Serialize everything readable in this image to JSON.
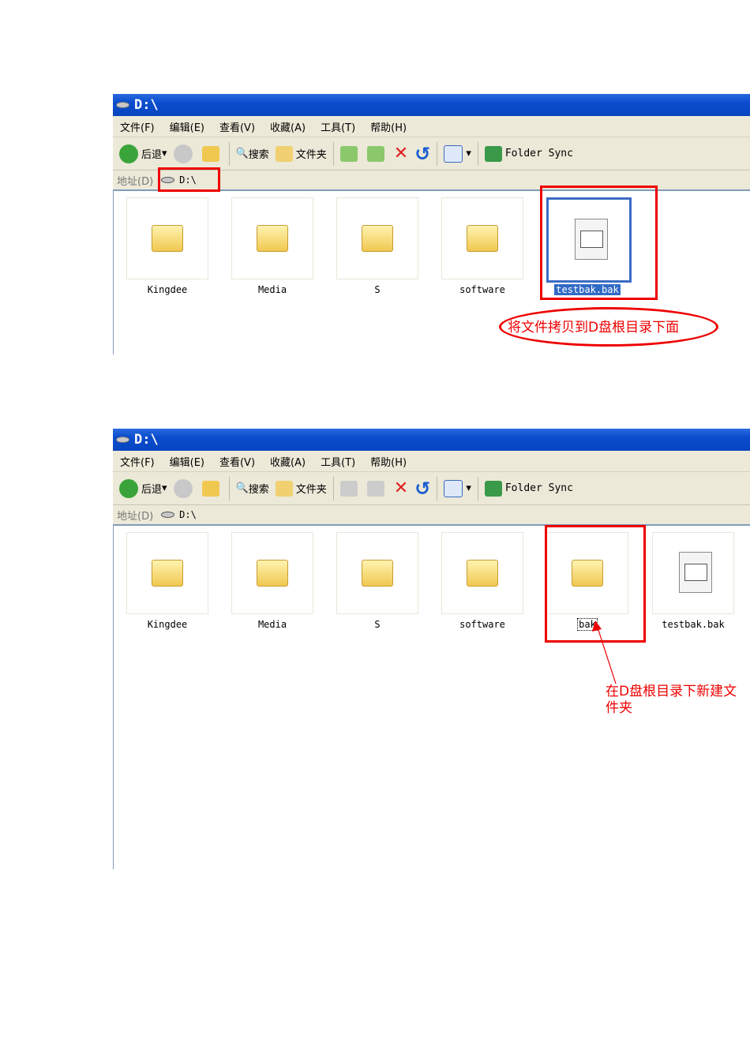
{
  "windows": [
    {
      "title": "D:\\",
      "menu": [
        "文件(F)",
        "编辑(E)",
        "查看(V)",
        "收藏(A)",
        "工具(T)",
        "帮助(H)"
      ],
      "toolbar": {
        "back": "后退",
        "search": "搜索",
        "folders": "文件夹",
        "sync": "Folder Sync"
      },
      "address": {
        "label": "地址(D)",
        "value": "D:\\"
      },
      "items": [
        {
          "name": "Kingdee",
          "type": "folder"
        },
        {
          "name": "Media",
          "type": "folder"
        },
        {
          "name": "S",
          "type": "folder"
        },
        {
          "name": "software",
          "type": "folder"
        },
        {
          "name": "testbak.bak",
          "type": "file",
          "selected": true
        }
      ],
      "annotation": "将文件拷贝到D盘根目录下面"
    },
    {
      "title": "D:\\",
      "menu": [
        "文件(F)",
        "编辑(E)",
        "查看(V)",
        "收藏(A)",
        "工具(T)",
        "帮助(H)"
      ],
      "toolbar": {
        "back": "后退",
        "search": "搜索",
        "folders": "文件夹",
        "sync": "Folder Sync"
      },
      "address": {
        "label": "地址(D)",
        "value": "D:\\"
      },
      "items": [
        {
          "name": "Kingdee",
          "type": "folder"
        },
        {
          "name": "Media",
          "type": "folder"
        },
        {
          "name": "S",
          "type": "folder"
        },
        {
          "name": "software",
          "type": "folder"
        },
        {
          "name": "bak",
          "type": "folder",
          "focused": true
        },
        {
          "name": "testbak.bak",
          "type": "file"
        }
      ],
      "annotation": [
        "在D盘根目录下新建文",
        "件夹"
      ]
    }
  ],
  "colors": {
    "annotation": "#e00000",
    "titlebar": "#0a4ccc"
  }
}
